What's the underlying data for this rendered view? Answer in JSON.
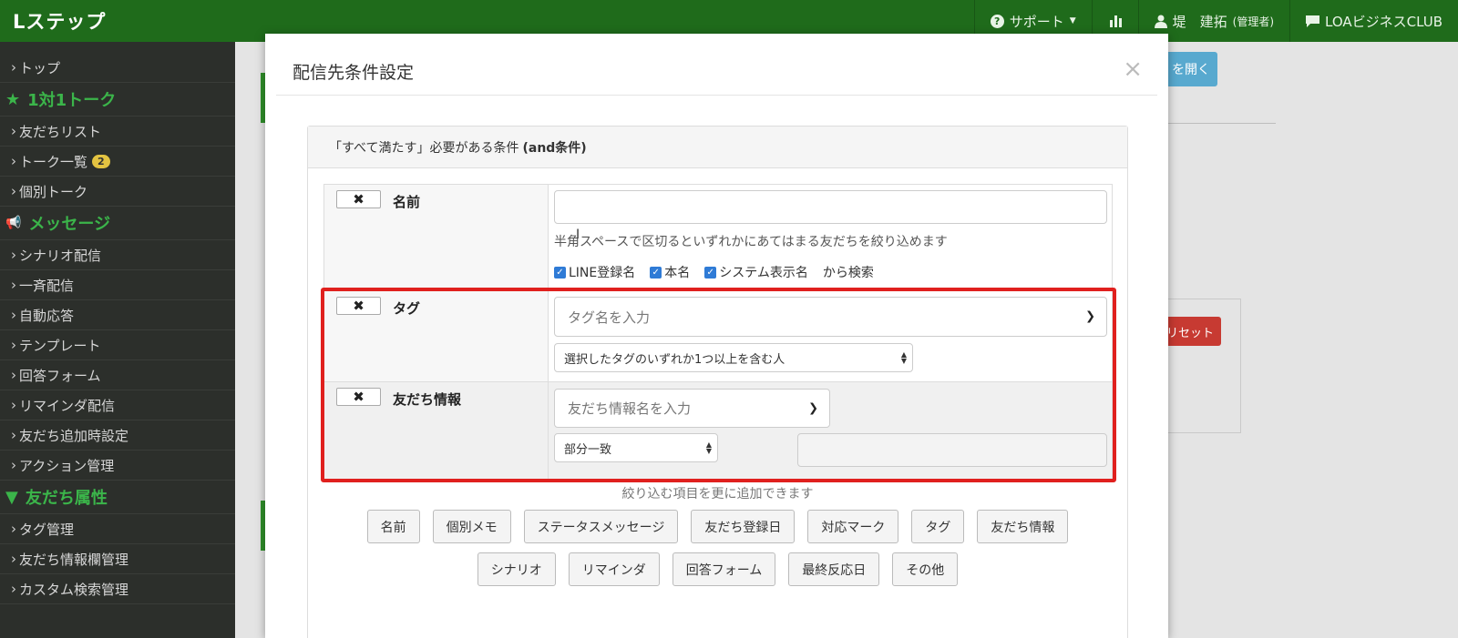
{
  "header": {
    "brand": "Lステップ",
    "support": "サポート",
    "user_name": "堤　建拓",
    "user_role": "(管理者)",
    "org": "LOAビジネスCLUB"
  },
  "sidebar": {
    "top": "トップ",
    "section1": "1対1トーク",
    "friend_list": "友だちリスト",
    "talk_list": "トーク一覧",
    "talk_badge": "2",
    "individual_talk": "個別トーク",
    "section2": "メッセージ",
    "scenario": "シナリオ配信",
    "broadcast": "一斉配信",
    "auto_reply": "自動応答",
    "template": "テンプレート",
    "answer_form": "回答フォーム",
    "reminder": "リマインダ配信",
    "friend_add": "友だち追加時設定",
    "action": "アクション管理",
    "section3": "友だち属性",
    "tag_mgmt": "タグ管理",
    "info_mgmt": "友だち情報欄管理",
    "custom_search": "カスタム検索管理"
  },
  "background": {
    "open_button": "を開く",
    "reset_button": "リセット"
  },
  "modal": {
    "title": "配信先条件設定",
    "close": "×",
    "panel_title_prefix": "「すべて満たす」必要がある条件",
    "panel_title_bold": "(and条件)",
    "name_label": "名前",
    "name_value": "",
    "name_help": "半角スペースで区切るといずれかにあてはまる友だちを絞り込めます",
    "check_line": "LINE登録名",
    "check_real": "本名",
    "check_system": "システム表示名",
    "search_suffix": "から検索",
    "tag_label": "タグ",
    "tag_placeholder": "タグ名を入力",
    "tag_match": "選択したタグのいずれか1つ以上を含む人",
    "info_label": "友だち情報",
    "info_placeholder": "友だち情報名を入力",
    "info_match": "部分一致",
    "info_value": "",
    "add_caption": "絞り込む項目を更に追加できます",
    "add_buttons_row1": [
      "名前",
      "個別メモ",
      "ステータスメッセージ",
      "友だち登録日",
      "対応マーク",
      "タグ",
      "友だち情報"
    ],
    "add_buttons_row2": [
      "シナリオ",
      "リマインダ",
      "回答フォーム",
      "最終反応日",
      "その他"
    ]
  },
  "colors": {
    "nav_green": "#1f6b1b",
    "accent_green": "#3bb54a",
    "highlight_red": "#e0201e",
    "checkbox_blue": "#2f7bd6"
  }
}
